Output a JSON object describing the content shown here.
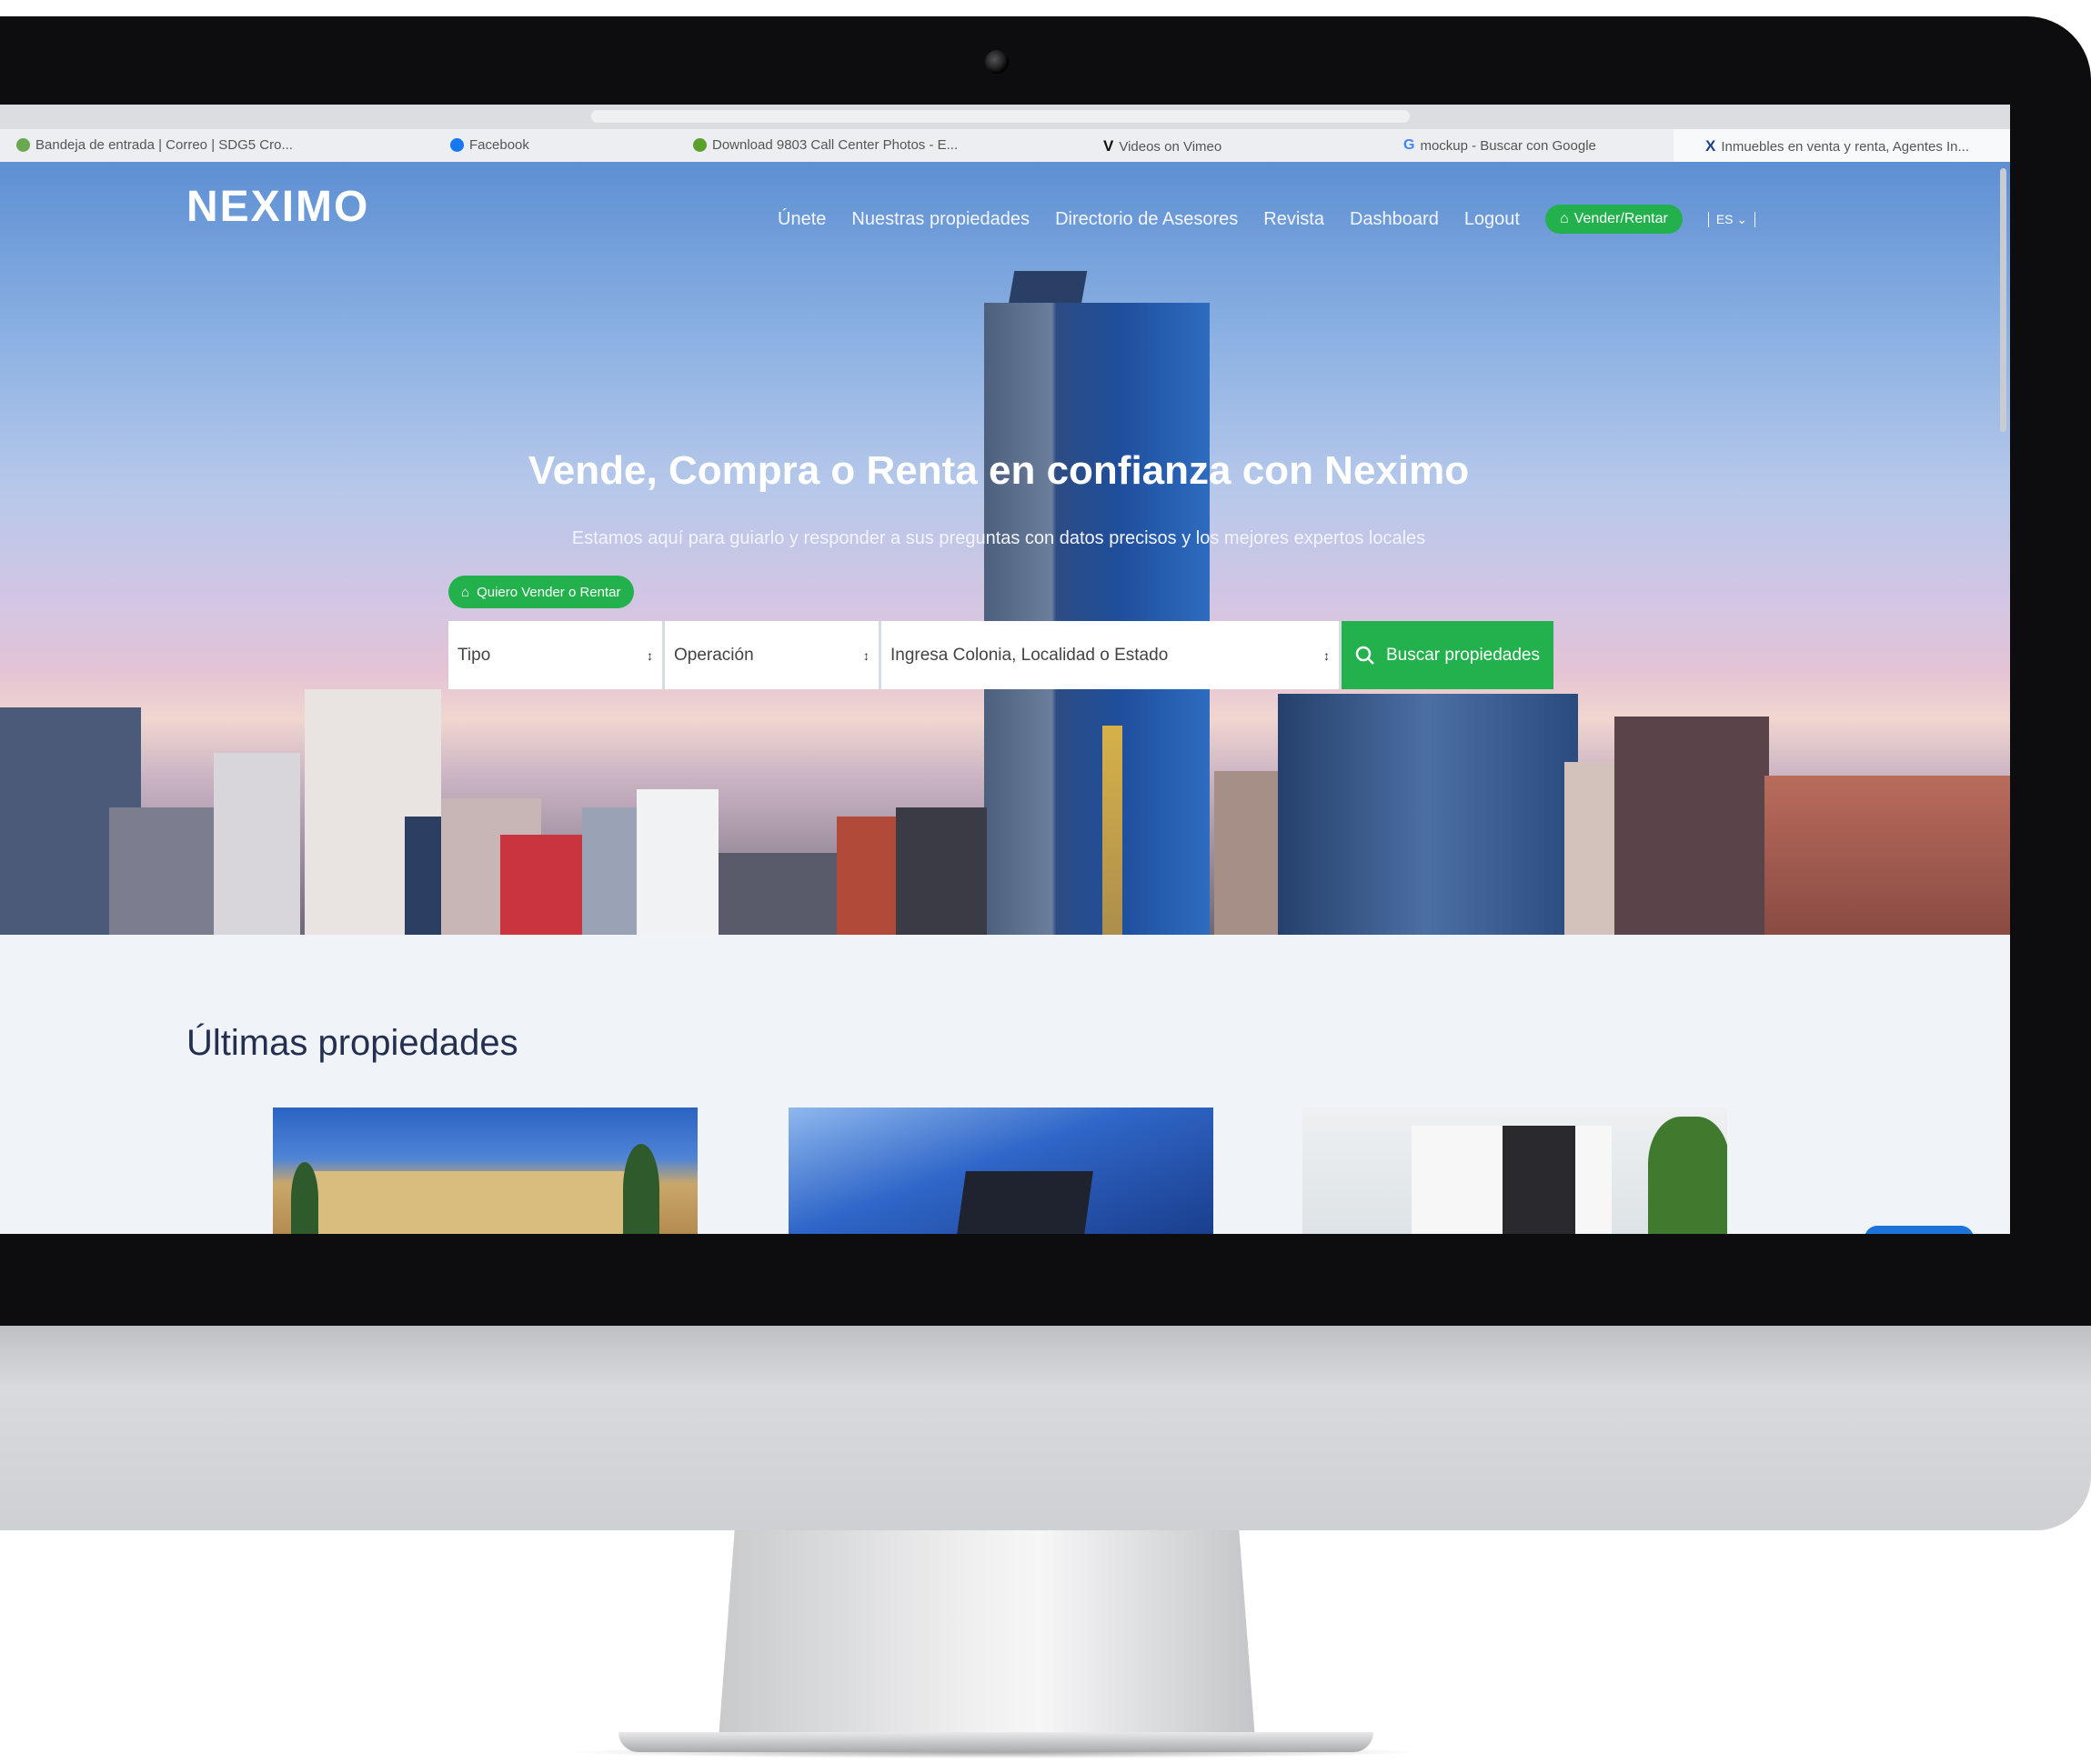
{
  "bookmarks": [
    {
      "label": "Bandeja de entrada | Correo | SDG5 Cro..."
    },
    {
      "label": "Facebook"
    },
    {
      "label": "Download 9803 Call Center Photos - E..."
    },
    {
      "label": "Videos on Vimeo"
    },
    {
      "label": "mockup - Buscar con Google"
    },
    {
      "label": "Inmuebles en venta y renta, Agentes In..."
    }
  ],
  "header": {
    "logo": "NEXIMO",
    "nav": [
      "Únete",
      "Nuestras propiedades",
      "Directorio de Asesores",
      "Revista",
      "Dashboard",
      "Logout"
    ],
    "cta": "Vender/Rentar",
    "lang": "ES"
  },
  "hero": {
    "title": "Vende, Compra o Renta en confianza con Neximo",
    "subtitle": "Estamos aquí para guiarlo y responder a sus preguntas con datos precisos y los mejores expertos locales",
    "quiero_button": "Quiero Vender o Rentar"
  },
  "search": {
    "tipo": "Tipo",
    "operacion": "Operación",
    "location": "Ingresa Colonia, Localidad o Estado",
    "button": "Buscar propiedades"
  },
  "latest": {
    "title": "Últimas propiedades"
  },
  "colors": {
    "accent": "#22b14c",
    "title": "#253050"
  },
  "icons": [
    "home-icon",
    "search-icon",
    "chevron-down-icon",
    "facebook-icon",
    "vimeo-icon",
    "google-icon"
  ]
}
